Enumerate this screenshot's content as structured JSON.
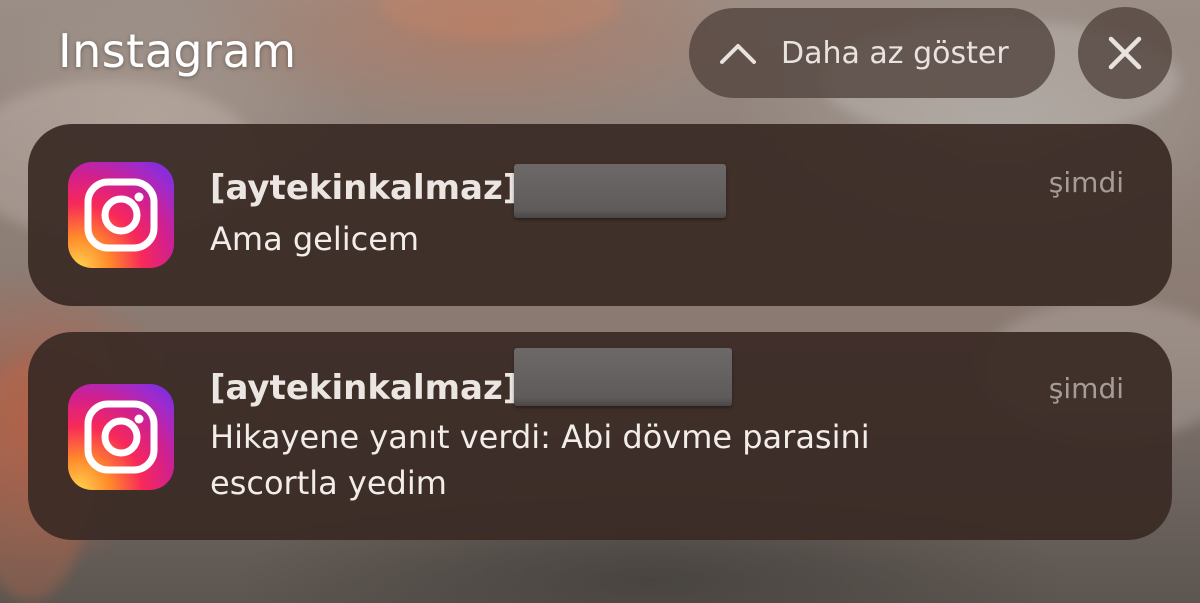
{
  "group": {
    "app_title": "Instagram",
    "show_less_label": "Daha az göster",
    "chevron_icon": "chevron-up-icon",
    "close_icon": "close-icon"
  },
  "notifications": [
    {
      "app_icon": "instagram-icon",
      "sender": "[aytekinkalmaz]",
      "time": "şimdi",
      "message_line1": "Ama gelicem",
      "message_line2": ""
    },
    {
      "app_icon": "instagram-icon",
      "sender": "[aytekinkalmaz]",
      "time": "şimdi",
      "message_line1": "Hikayene yanıt verdi: Abi dövme parasini",
      "message_line2": "escortla yedim"
    }
  ],
  "colors": {
    "card_background": "#3a2a25",
    "pill_background": "#544640",
    "text_primary": "#f2ede9",
    "text_secondary": "#a59c97"
  }
}
